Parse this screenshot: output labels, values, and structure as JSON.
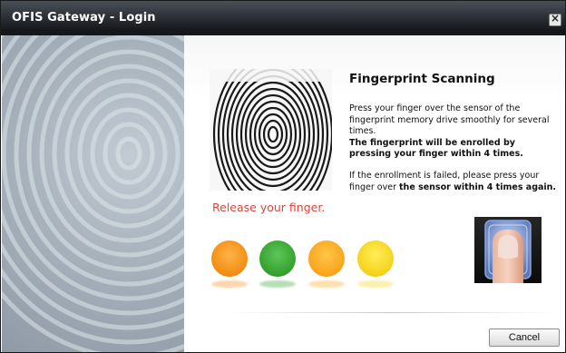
{
  "window": {
    "title": "OFIS Gateway - Login",
    "close_icon": "close-icon"
  },
  "scan": {
    "heading": "Fingerprint Scanning",
    "line1": "Press your finger over the sensor of the fingerprint memory drive smoothly for several times.",
    "line2": "The fingerprint will be enrolled by pressing your finger within 4 times.",
    "line3_prefix": "If the enrollment is failed, please press your finger over ",
    "line3_bold": "the sensor within 4 times again.",
    "status": "Release your finger."
  },
  "progress": {
    "indicators": [
      {
        "name": "indicator-1",
        "color": "#f28c13"
      },
      {
        "name": "indicator-2",
        "color": "#33a02c"
      },
      {
        "name": "indicator-3",
        "color": "#f9a51b"
      },
      {
        "name": "indicator-4",
        "color": "#f5d21a"
      }
    ]
  },
  "buttons": {
    "cancel": "Cancel"
  }
}
